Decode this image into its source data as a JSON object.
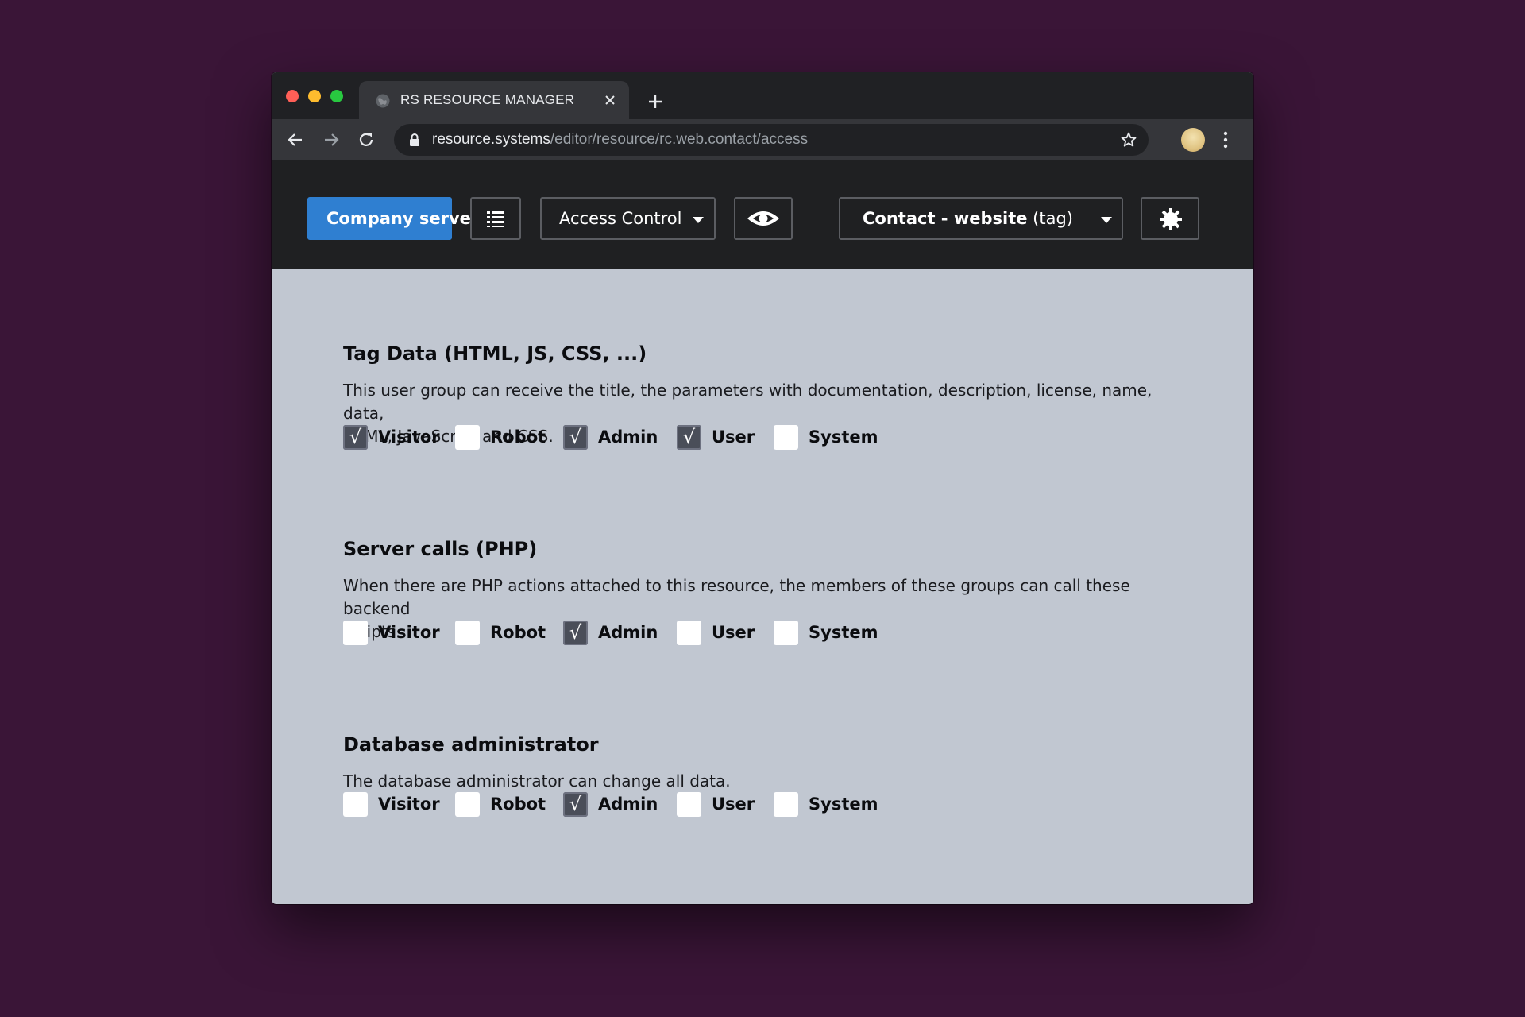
{
  "browser": {
    "tab_title": "RS RESOURCE MANAGER",
    "url_host": "resource.systems",
    "url_path": "/editor/resource/rc.web.contact/access"
  },
  "toolbar": {
    "server_label": "Company server",
    "access_label": "Access Control",
    "resource_name_bold": "Contact - website",
    "resource_type": " (tag)"
  },
  "sections": [
    {
      "title": "Tag Data (HTML, JS, CSS, ...)",
      "description_lines": [
        "This user group can receive the title, the parameters with documentation, description, license, name, data,",
        "HTML, JavaScript and CSS."
      ],
      "groups": [
        {
          "label": "Visitor",
          "checked": true
        },
        {
          "label": "Robot",
          "checked": false
        },
        {
          "label": "Admin",
          "checked": true
        },
        {
          "label": "User",
          "checked": true
        },
        {
          "label": "System",
          "checked": false
        }
      ]
    },
    {
      "title": "Server calls (PHP)",
      "description_lines": [
        "When there are PHP actions attached to this resource, the members of these groups can call these backend",
        "scripts."
      ],
      "groups": [
        {
          "label": "Visitor",
          "checked": false
        },
        {
          "label": "Robot",
          "checked": false
        },
        {
          "label": "Admin",
          "checked": true
        },
        {
          "label": "User",
          "checked": false
        },
        {
          "label": "System",
          "checked": false
        }
      ]
    },
    {
      "title": "Database administrator",
      "description_lines": [
        "The database administrator can change all data."
      ],
      "groups": [
        {
          "label": "Visitor",
          "checked": false
        },
        {
          "label": "Robot",
          "checked": false
        },
        {
          "label": "Admin",
          "checked": true
        },
        {
          "label": "User",
          "checked": false
        },
        {
          "label": "System",
          "checked": false
        }
      ]
    }
  ],
  "colors": {
    "background": "#3a1537",
    "primary_button": "#2f7fd1",
    "content_bg": "#c1c7d1",
    "checkbox_checked": "#4a4e59"
  }
}
